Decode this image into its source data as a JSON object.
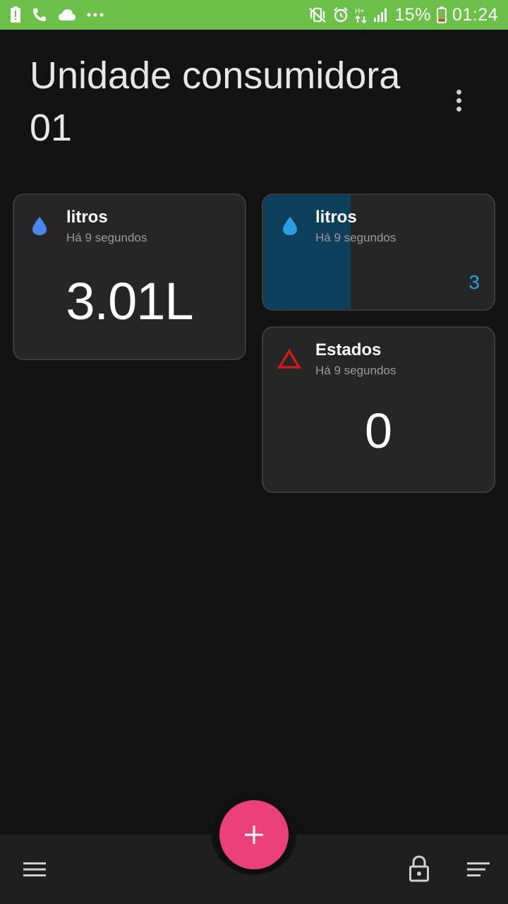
{
  "status_bar": {
    "battery_percent": "15%",
    "time": "01:24",
    "network_label": "H+",
    "icons": [
      "battery-alert-icon",
      "phone-call-icon",
      "cloud-icon",
      "more-dots-icon",
      "vibrate-icon",
      "alarm-icon",
      "data-icon",
      "signal-icon",
      "battery-icon"
    ]
  },
  "header": {
    "title": "Unidade consumidora 01",
    "menu_icon": "more-vert-icon"
  },
  "cards": [
    {
      "title": "litros",
      "subtitle": "Há 9 segundos",
      "value": "3.01L",
      "icon": "water-drop-icon",
      "icon_color": "#4a86f0"
    },
    {
      "title": "litros",
      "subtitle": "Há 9 segundos",
      "value": "3",
      "progress": 0.38,
      "icon": "water-drop-icon",
      "icon_color": "#2a9ee0",
      "fill_color": "#0e3f5a"
    },
    {
      "title": "Estados",
      "subtitle": "Há 9 segundos",
      "value": "0",
      "icon": "warning-triangle-icon",
      "icon_color": "#d01a1a"
    }
  ],
  "bottom_bar": {
    "left_icon": "menu-icon",
    "fab_icon": "add-icon",
    "fab_color": "#ec407a",
    "right_icons": [
      "lock-icon",
      "sort-icon"
    ]
  }
}
